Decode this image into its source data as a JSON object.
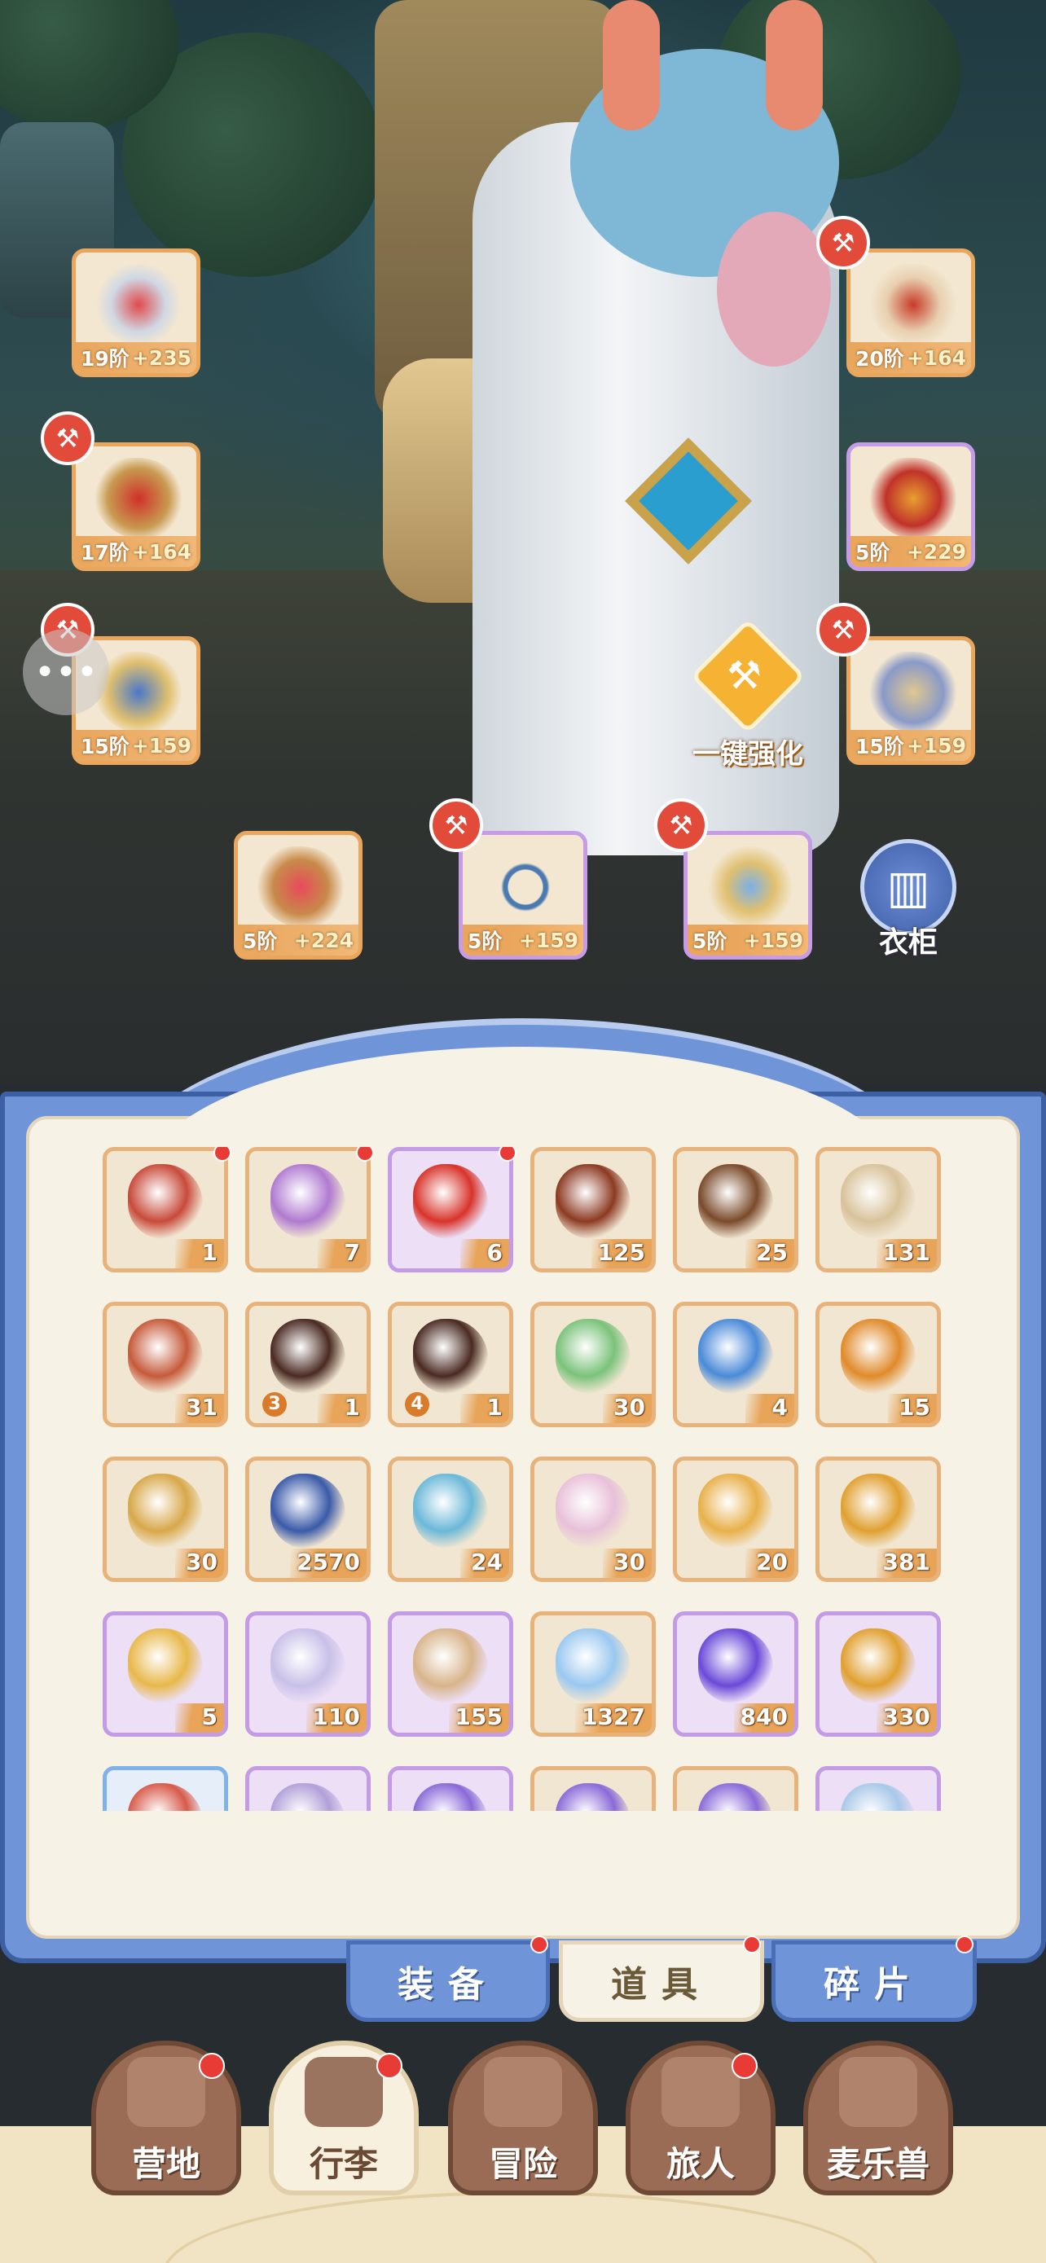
{
  "equipment": {
    "left": [
      {
        "name": "sword",
        "tier": "19阶",
        "bonus": "+235",
        "rarity": "orange"
      },
      {
        "name": "armor",
        "tier": "17阶",
        "bonus": "+164",
        "rarity": "orange"
      },
      {
        "name": "leggings",
        "tier": "15阶",
        "bonus": "+159",
        "rarity": "orange"
      }
    ],
    "right": [
      {
        "name": "helmet",
        "tier": "20阶",
        "bonus": "+164",
        "rarity": "orange"
      },
      {
        "name": "gauntlet",
        "tier": "5阶",
        "bonus": "+229",
        "rarity": "purple"
      },
      {
        "name": "boots",
        "tier": "15阶",
        "bonus": "+159",
        "rarity": "orange"
      }
    ],
    "bottom": [
      {
        "name": "ring",
        "tier": "5阶",
        "bonus": "+224",
        "rarity": "orange"
      },
      {
        "name": "necklace",
        "tier": "5阶",
        "bonus": "+159",
        "rarity": "purple"
      },
      {
        "name": "amulet",
        "tier": "5阶",
        "bonus": "+159",
        "rarity": "purple"
      }
    ]
  },
  "enhance_label": "一键强化",
  "wardrobe_label": "衣柜",
  "chat_icon": "chat-bubble-icon",
  "inventory": [
    {
      "icon": "red-card-icon",
      "qty": "1",
      "rarity": "orange",
      "dot": true,
      "color": "#c84a3a"
    },
    {
      "icon": "crystal-ore-icon",
      "qty": "7",
      "rarity": "orange",
      "dot": true,
      "color": "#b07ad0"
    },
    {
      "icon": "apple-icon",
      "qty": "6",
      "rarity": "purple",
      "dot": true,
      "color": "#d8332a"
    },
    {
      "icon": "ticket-icon",
      "qty": "125",
      "rarity": "orange",
      "color": "#8c3a22"
    },
    {
      "icon": "log-icon",
      "qty": "25",
      "rarity": "orange",
      "color": "#7a4a2a"
    },
    {
      "icon": "golden-spoon-icon",
      "qty": "131",
      "rarity": "orange",
      "color": "#d8c29a"
    },
    {
      "icon": "seed-bag-icon",
      "qty": "31",
      "rarity": "orange",
      "color": "#c65a3a"
    },
    {
      "icon": "saddle-icon",
      "qty": "1",
      "level": "3",
      "rarity": "orange",
      "color": "#4a2a22"
    },
    {
      "icon": "saddle-icon",
      "qty": "1",
      "level": "4",
      "rarity": "orange",
      "color": "#4a2a22"
    },
    {
      "icon": "paper-plane-icon",
      "qty": "30",
      "rarity": "orange",
      "color": "#7ac27a"
    },
    {
      "icon": "potion-icon",
      "qty": "4",
      "rarity": "orange",
      "color": "#4a8ad8"
    },
    {
      "icon": "cat-coin-icon",
      "qty": "15",
      "rarity": "orange",
      "color": "#e08a2a"
    },
    {
      "icon": "lyre-icon",
      "qty": "30",
      "rarity": "orange",
      "color": "#d8a84a"
    },
    {
      "icon": "star-coin-icon",
      "qty": "2570",
      "rarity": "orange",
      "color": "#3a5aa8"
    },
    {
      "icon": "ice-crystal-icon",
      "qty": "24",
      "rarity": "orange",
      "color": "#6ab8d8"
    },
    {
      "icon": "rainbow-paint-icon",
      "qty": "30",
      "rarity": "orange",
      "color": "#e8c0d8"
    },
    {
      "icon": "paint-splash-icon",
      "qty": "20",
      "rarity": "orange",
      "color": "#e8b04a"
    },
    {
      "icon": "bell-icon",
      "qty": "381",
      "rarity": "orange",
      "color": "#e0a030"
    },
    {
      "icon": "paw-stamp-icon",
      "qty": "5",
      "rarity": "purple",
      "color": "#e8b84a"
    },
    {
      "icon": "cat-spoon-icon",
      "qty": "110",
      "rarity": "purple",
      "color": "#c8c0e8"
    },
    {
      "icon": "flour-sack-icon",
      "qty": "155",
      "rarity": "purple",
      "color": "#d8b48a"
    },
    {
      "icon": "star-shard-icon",
      "qty": "1327",
      "rarity": "orange",
      "color": "#9ac8f0"
    },
    {
      "icon": "purple-gem-icon",
      "qty": "840",
      "rarity": "purple",
      "color": "#6a4ad8"
    },
    {
      "icon": "amber-egg-icon",
      "qty": "330",
      "rarity": "purple",
      "color": "#e0a030"
    },
    {
      "icon": "partial-item-icon",
      "qty": "",
      "rarity": "blue",
      "color": "#d85a4a"
    },
    {
      "icon": "partial-item-icon",
      "qty": "",
      "rarity": "purple",
      "color": "#b0a0d8"
    },
    {
      "icon": "partial-item-icon",
      "qty": "",
      "rarity": "purple",
      "color": "#8a6ad8"
    },
    {
      "icon": "partial-item-icon",
      "qty": "",
      "rarity": "orange",
      "color": "#8a6ad8"
    },
    {
      "icon": "partial-item-icon",
      "qty": "",
      "rarity": "orange",
      "color": "#8a6ad8"
    },
    {
      "icon": "partial-item-icon",
      "qty": "",
      "rarity": "purple",
      "color": "#a8c8e8"
    }
  ],
  "tabs": [
    {
      "label": "装备",
      "active": false,
      "dot": true
    },
    {
      "label": "道具",
      "active": true,
      "dot": true
    },
    {
      "label": "碎片",
      "active": false,
      "dot": true
    }
  ],
  "nav": [
    {
      "label": "营地",
      "icon": "castle-icon",
      "active": false,
      "dot": true
    },
    {
      "label": "行李",
      "icon": "backpack-icon",
      "active": true,
      "dot": true
    },
    {
      "label": "冒险",
      "icon": "crossed-swords-icon",
      "active": false,
      "dot": false
    },
    {
      "label": "旅人",
      "icon": "traveler-icon",
      "active": false,
      "dot": true
    },
    {
      "label": "麦乐兽",
      "icon": "cat-face-icon",
      "active": false,
      "dot": false
    }
  ]
}
